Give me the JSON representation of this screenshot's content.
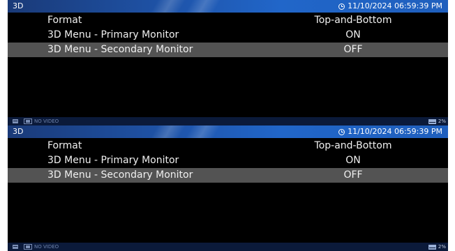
{
  "screens": [
    {
      "title": "3D",
      "datetime": "11/10/2024 06:59:39 PM",
      "menu": [
        {
          "label": "Format",
          "value": "Top-and-Bottom",
          "selected": false
        },
        {
          "label": "3D Menu - Primary Monitor",
          "value": "ON",
          "selected": false
        },
        {
          "label": "3D Menu - Secondary Monitor",
          "value": "OFF",
          "selected": true
        }
      ],
      "status": {
        "video": "NO VIDEO",
        "storage": "2%"
      }
    },
    {
      "title": "3D",
      "datetime": "11/10/2024 06:59:39 PM",
      "menu": [
        {
          "label": "Format",
          "value": "Top-and-Bottom",
          "selected": false
        },
        {
          "label": "3D Menu - Primary Monitor",
          "value": "ON",
          "selected": false
        },
        {
          "label": "3D Menu - Secondary Monitor",
          "value": "OFF",
          "selected": true
        }
      ],
      "status": {
        "video": "NO VIDEO",
        "storage": "2%"
      }
    }
  ],
  "colors": {
    "titlebar": "#1f56ad",
    "selected_row": "#535353",
    "statusbar": "#0b1a3a",
    "background": "#000000"
  },
  "icons": {
    "clock": "clock-icon",
    "storage": "hdd-icon",
    "video": "video-icon",
    "disk": "disk-usage-icon"
  }
}
